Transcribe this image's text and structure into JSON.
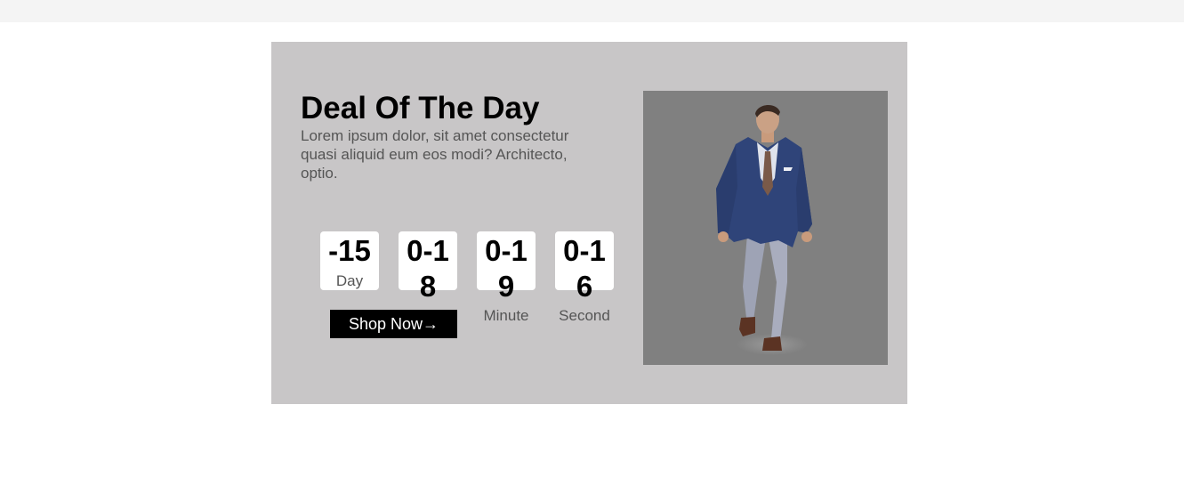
{
  "deal": {
    "title": "Deal Of The Day",
    "description": "Lorem ipsum dolor, sit amet consectetur quasi aliquid eum eos modi? Architecto, optio.",
    "countdown": [
      {
        "value": "-15",
        "label": "Day"
      },
      {
        "value": "0-18",
        "label": ""
      },
      {
        "value": "0-19",
        "label": "Minute"
      },
      {
        "value": "0-16",
        "label": "Second"
      }
    ],
    "button_label": "Shop Now→",
    "image_alt": "man in blue suit"
  },
  "colors": {
    "card_bg": "#c8c6c7",
    "image_bg": "#808080",
    "button_bg": "#000000"
  }
}
